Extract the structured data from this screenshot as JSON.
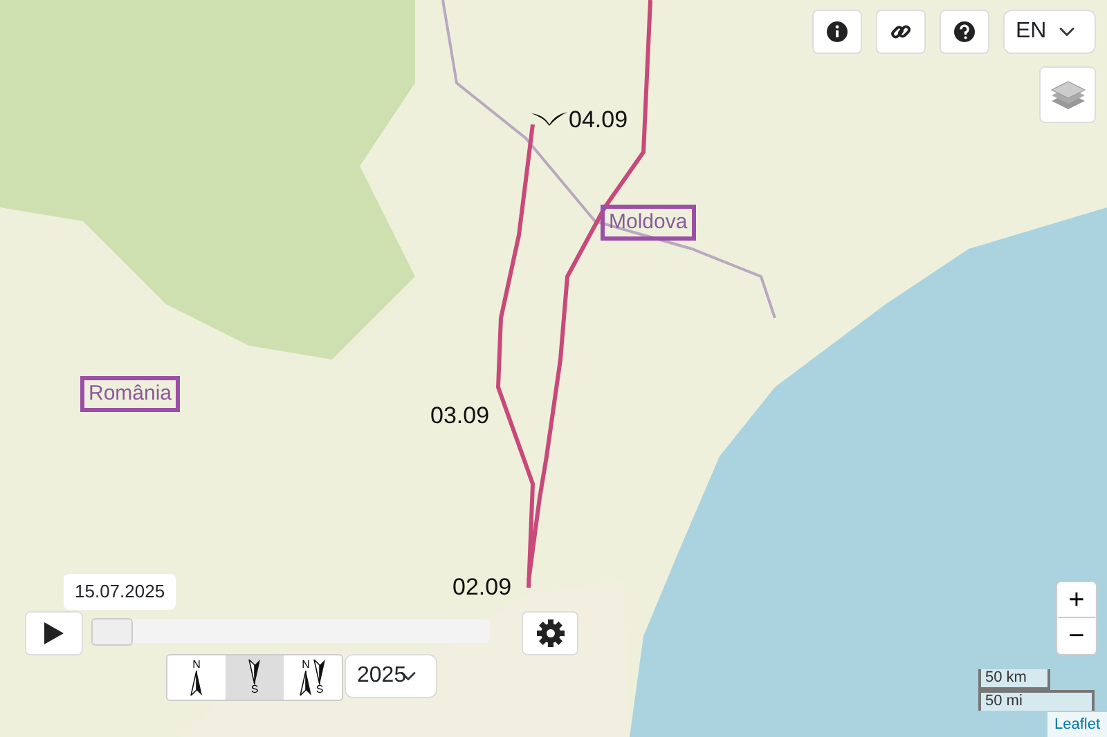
{
  "language": {
    "value": "EN"
  },
  "region_labels": [
    {
      "text": "Moldova"
    },
    {
      "text": "România"
    }
  ],
  "date_labels": [
    "04.09",
    "03.09",
    "02.09"
  ],
  "timeline": {
    "date": "15.07.2025",
    "level": 0.0
  },
  "modes": [
    {
      "top": "N",
      "selected": false
    },
    {
      "bottom": "S",
      "selected": true
    },
    {
      "top": "N",
      "bottom": "S",
      "selected": false
    }
  ],
  "year": {
    "value": "2025"
  },
  "zoom": {
    "in": "+",
    "out": "−"
  },
  "scale": [
    "50 km",
    "50 mi"
  ],
  "attribution": "Leaflet"
}
